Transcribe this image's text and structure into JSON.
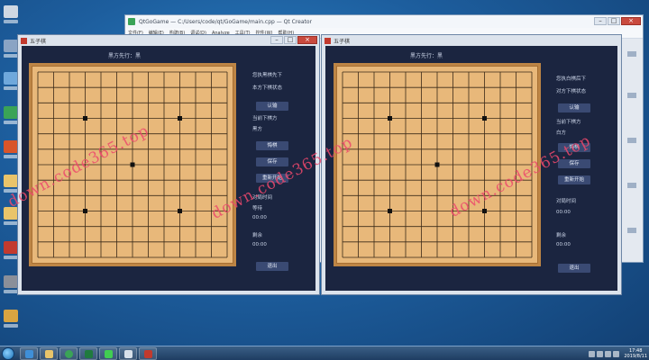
{
  "ide": {
    "title": "QtGoGame — C:/Users/code/qt/GoGame/main.cpp — Qt Creator",
    "menu": [
      "文件(F)",
      "编辑(E)",
      "构建(B)",
      "调试(D)",
      "Analyze",
      "工具(T)",
      "控件(W)",
      "帮助(H)"
    ]
  },
  "left_window": {
    "title": "五子棋",
    "turn": "黑方先行：黑",
    "stones": [
      [
        3,
        3
      ],
      [
        9,
        3
      ],
      [
        6,
        6
      ],
      [
        3,
        9
      ],
      [
        9,
        9
      ]
    ],
    "side_texts": [
      "您执黑棋先下",
      "本方下棋状态",
      "认输",
      "当前下棋方",
      "黑方",
      "悔棋",
      "保存",
      "重新开始",
      "对局时间",
      "等待",
      "00:00",
      "剩余",
      "00:00"
    ],
    "exit_label": "退出"
  },
  "right_window": {
    "title": "五子棋",
    "turn": "黑方先行：黑",
    "stones": [
      [
        3,
        3
      ],
      [
        9,
        3
      ],
      [
        6,
        6
      ],
      [
        3,
        9
      ],
      [
        9,
        9
      ]
    ],
    "side_texts": [
      "您执白棋后下",
      "对方下棋状态",
      "认输",
      "当前下棋方",
      "白方",
      "悔棋",
      "保存",
      "重新开始",
      "对局时间",
      "00:00",
      "剩余",
      "00:00"
    ],
    "exit_label": "退出"
  },
  "watermark": {
    "text": "down.code365.top"
  },
  "taskbar": {
    "apps": [
      "start",
      "ie-icon",
      "explorer-icon",
      "chrome-icon",
      "excel-icon",
      "qt-icon",
      "note-icon",
      "app-icon"
    ],
    "clock_time": "17:48",
    "clock_date": "2019/8/11"
  },
  "colors": {
    "board": "#e8b87a",
    "board_border": "#bd8545",
    "game_bg": "#1b2540",
    "button": "#3a4a73",
    "watermark": "#ec486c"
  }
}
